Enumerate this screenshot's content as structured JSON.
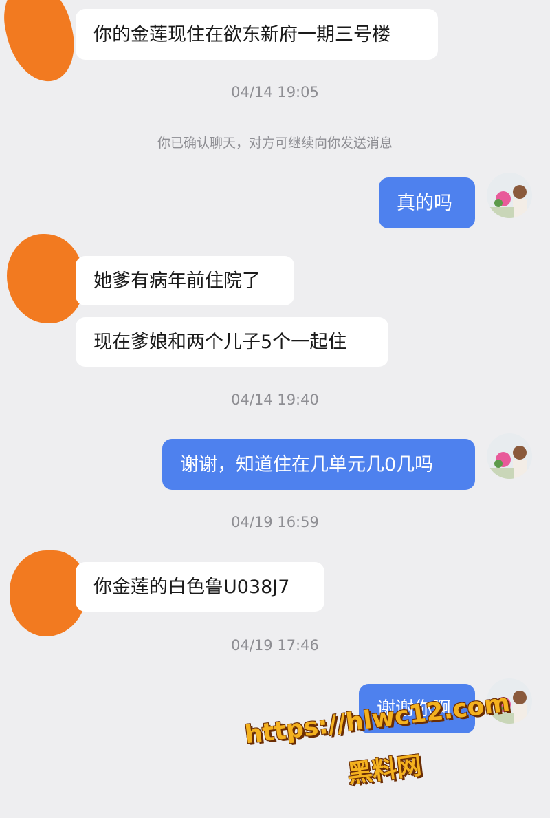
{
  "messages": [
    {
      "text": "你的金莲现住在欲东新府一期三号楼"
    },
    {
      "time": "04/14 19:05"
    },
    {
      "notice": "你已确认聊天，对方可继续向你发送消息"
    },
    {
      "text": "真的吗"
    },
    {
      "text": "她爹有病年前住院了"
    },
    {
      "text": "现在爹娘和两个儿子5个一起住"
    },
    {
      "time": "04/14 19:40"
    },
    {
      "text": "谢谢，知道住在几单元几0几吗"
    },
    {
      "time": "04/19 16:59"
    },
    {
      "text": "你金莲的白色鲁U038J7"
    },
    {
      "time": "04/19 17:46"
    },
    {
      "text": "谢谢你啊"
    }
  ],
  "watermark": {
    "url": "https://hlwc12.com",
    "label": "黑料网"
  },
  "colors": {
    "background": "#eeeef0",
    "incoming_bubble": "#ffffff",
    "outgoing_bubble": "#4e81ee",
    "redaction": "#f27a20",
    "watermark": "#f4b21f"
  },
  "icons": {
    "avatar": "user-avatar-icon",
    "redaction": "redaction-scribble"
  }
}
